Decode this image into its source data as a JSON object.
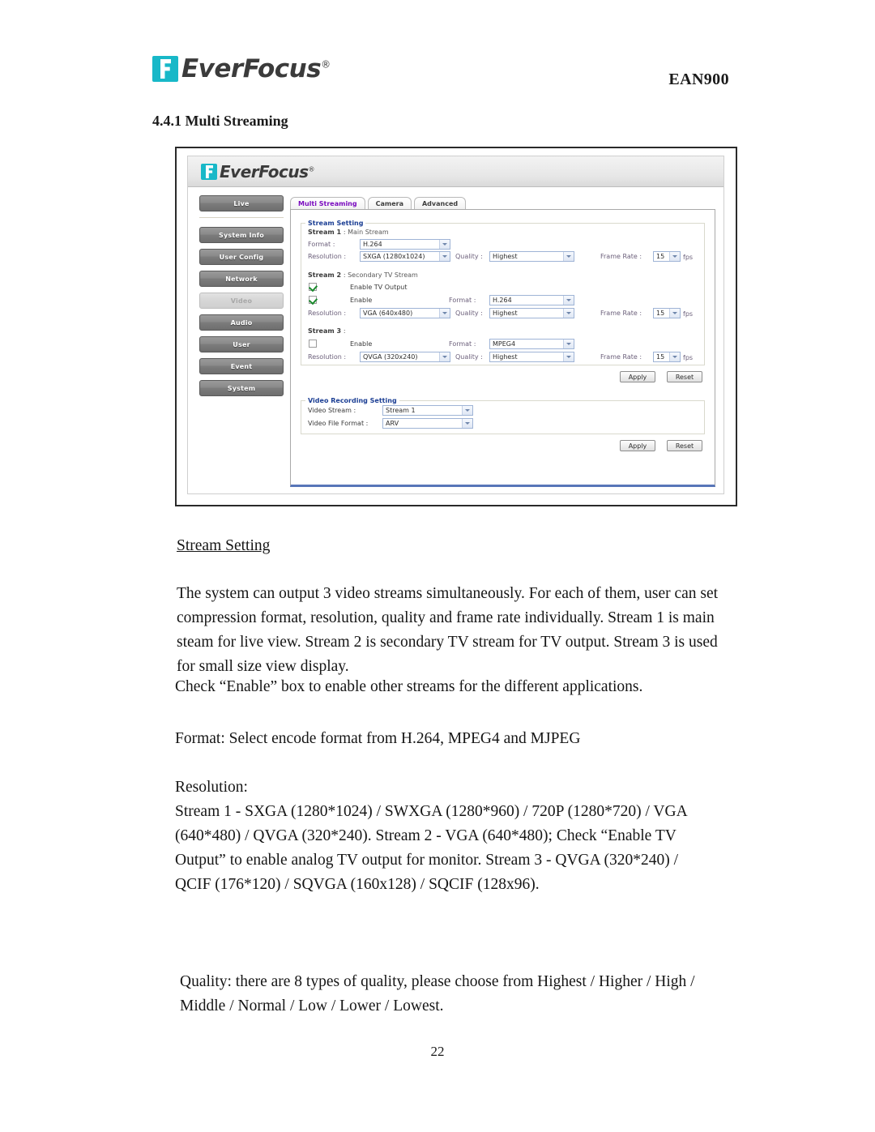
{
  "header": {
    "brand": "EverFocus",
    "brand_reg": "®",
    "model": "EAN900"
  },
  "section": {
    "number_title": "4.4.1 Multi Streaming"
  },
  "screenshot": {
    "app_brand": "EverFocus",
    "app_brand_reg": "®",
    "sidebar": {
      "top_items": [
        {
          "label": "Live",
          "active": false
        }
      ],
      "items": [
        {
          "label": "System Info",
          "active": false
        },
        {
          "label": "User Config",
          "active": false
        },
        {
          "label": "Network",
          "active": false
        },
        {
          "label": "Video",
          "active": true
        },
        {
          "label": "Audio",
          "active": false
        },
        {
          "label": "User",
          "active": false
        },
        {
          "label": "Event",
          "active": false
        },
        {
          "label": "System",
          "active": false
        }
      ]
    },
    "tabs": [
      {
        "label": "Multi Streaming",
        "selected": true
      },
      {
        "label": "Camera",
        "selected": false
      },
      {
        "label": "Advanced",
        "selected": false
      }
    ],
    "stream_setting": {
      "legend": "Stream Setting",
      "stream1": {
        "title": "Stream 1",
        "subtitle": ": Main Stream",
        "format_label": "Format :",
        "format_value": "H.264",
        "resolution_label": "Resolution :",
        "resolution_value": "SXGA (1280x1024)",
        "quality_label": "Quality :",
        "quality_value": "Highest",
        "framerate_label": "Frame Rate :",
        "framerate_value": "15",
        "fps_unit": "fps"
      },
      "stream2": {
        "title": "Stream 2",
        "subtitle": ": Secondary TV Stream",
        "tv_output_label": "Enable TV Output",
        "tv_output_checked": true,
        "enable_label": "Enable",
        "enable_checked": true,
        "format_label": "Format :",
        "format_value": "H.264",
        "resolution_label": "Resolution :",
        "resolution_value": "VGA (640x480)",
        "quality_label": "Quality :",
        "quality_value": "Highest",
        "framerate_label": "Frame Rate :",
        "framerate_value": "15",
        "fps_unit": "fps"
      },
      "stream3": {
        "title": "Stream 3",
        "subtitle": ":",
        "enable_label": "Enable",
        "enable_checked": false,
        "format_label": "Format :",
        "format_value": "MPEG4",
        "resolution_label": "Resolution :",
        "resolution_value": "QVGA (320x240)",
        "quality_label": "Quality :",
        "quality_value": "Highest",
        "framerate_label": "Frame Rate :",
        "framerate_value": "15",
        "fps_unit": "fps"
      },
      "apply_label": "Apply",
      "reset_label": "Reset"
    },
    "video_recording_setting": {
      "legend": "Video Recording Setting",
      "video_stream_label": "Video Stream :",
      "video_stream_value": "Stream 1",
      "video_file_format_label": "Video File Format :",
      "video_file_format_value": "ARV",
      "apply_label": "Apply",
      "reset_label": "Reset"
    }
  },
  "body": {
    "stream_setting_heading": "Stream Setting",
    "paragraph1": "The system can output 3 video streams simultaneously. For each of them, user can set compression format, resolution, quality and frame rate individually. Stream 1 is main steam for live view. Stream 2 is secondary TV stream for TV output. Stream 3 is used for small size view display.",
    "paragraph2": "Check “Enable” box to enable other streams for the different applications.",
    "format_line": "Format: Select encode format from H.264, MPEG4 and MJPEG",
    "resolution_heading": "Resolution:",
    "resolution_body": "Stream 1 - SXGA (1280*1024) / SWXGA (1280*960) / 720P (1280*720) / VGA (640*480) / QVGA (320*240). Stream 2 - VGA (640*480); Check “Enable TV Output” to enable analog TV output for monitor. Stream 3 - QVGA (320*240) / QCIF (176*120) / SQVGA (160x128) / SQCIF (128x96).",
    "quality_line": "Quality: there are 8 types of quality, please choose from Highest / Higher / High / Middle / Normal / Low / Lower / Lowest."
  },
  "footer": {
    "page_number": "22"
  },
  "colors": {
    "brand_cyan": "#18b8c8",
    "tab_selected": "#7a0bbf",
    "legend_blue": "#1c3f94",
    "label_purple": "#6b5f7a",
    "panel_accent": "#5876b8"
  }
}
